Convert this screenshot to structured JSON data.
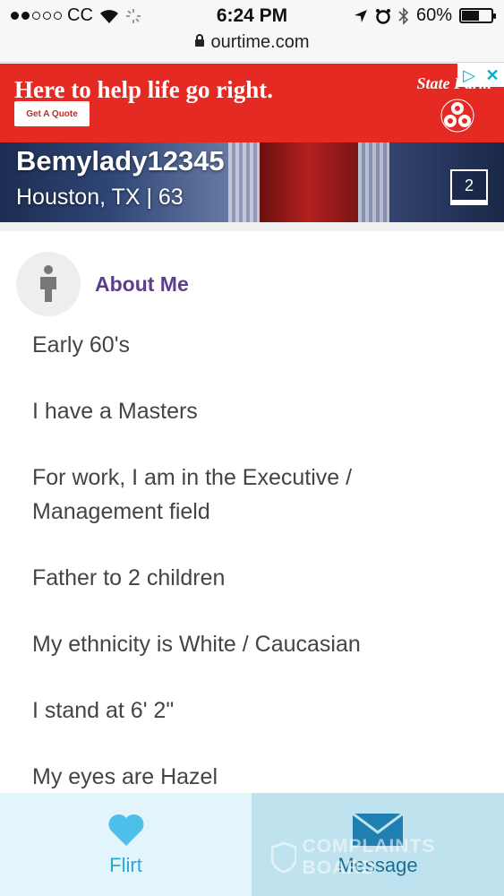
{
  "status_bar": {
    "carrier": "CC",
    "time": "6:24 PM",
    "battery": "60%",
    "battery_level": 0.6
  },
  "browser": {
    "url": "ourtime.com"
  },
  "ad": {
    "headline": "Here to help life go right.",
    "cta": "Get A Quote",
    "brand": "State Farm",
    "brand_color": "#e52a24"
  },
  "profile": {
    "username": "Bemylady12345",
    "location": "Houston, TX | 63",
    "photo_count": "2"
  },
  "about": {
    "title": "About Me",
    "title_color": "#5a3f8a",
    "items": [
      "Early 60's",
      "I have a Masters",
      "For work, I am in the Executive / Management field",
      "Father to 2 children",
      "My ethnicity is White / Caucasian",
      "I stand at 6' 2\"",
      "My eyes are Hazel"
    ]
  },
  "actions": {
    "flirt_label": "Flirt",
    "message_label": "Message",
    "accent": "#2aa8d8"
  },
  "watermark": {
    "text": "COMPLAINTS BOARD"
  }
}
